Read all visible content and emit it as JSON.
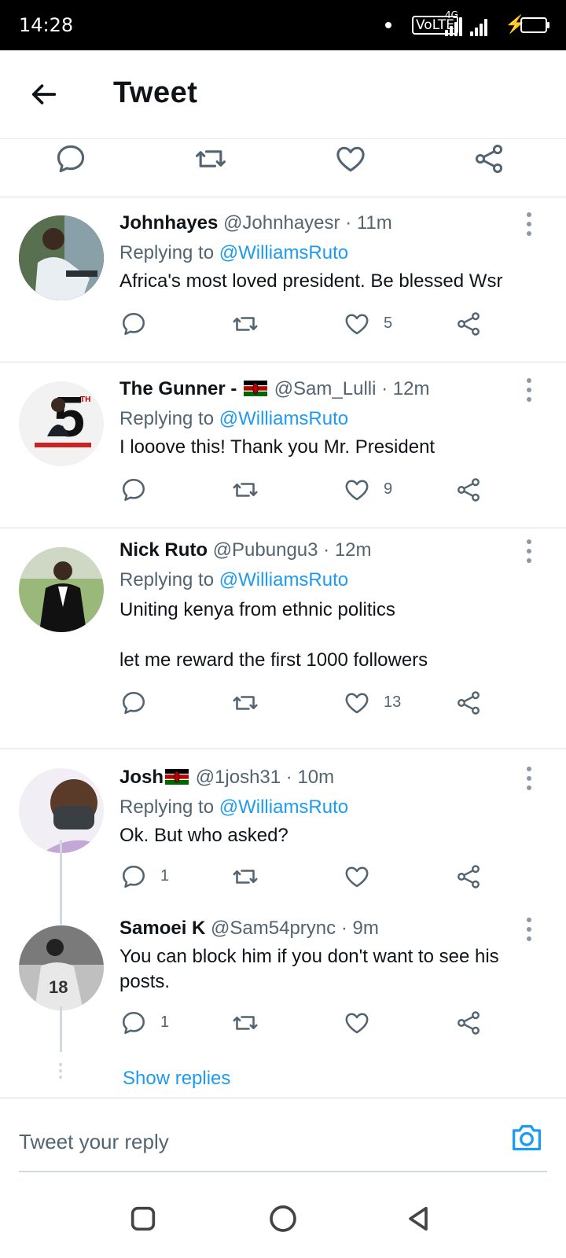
{
  "status": {
    "time": "14:28",
    "network": "VoLTE",
    "net_type": "4G"
  },
  "header": {
    "title": "Tweet"
  },
  "tweets": [
    {
      "name": "Johnhayes",
      "handle": "@Johnhayesr",
      "time": "· 11m",
      "replying_label": "Replying to",
      "replying_to": "@WilliamsRuto",
      "text": "Africa's most loved president. Be blessed Wsr",
      "likes": "5",
      "replies": ""
    },
    {
      "name": "The Gunner -",
      "handle": "@Sam_Lulli",
      "time": "· 12m",
      "replying_label": "Replying to",
      "replying_to": "@WilliamsRuto",
      "text": "I looove this! Thank you Mr. President",
      "likes": "9",
      "replies": ""
    },
    {
      "name": "Nick Ruto",
      "handle": "@Pubungu3",
      "time": "· 12m",
      "replying_label": "Replying to",
      "replying_to": "@WilliamsRuto",
      "text": "Uniting kenya from ethnic politics",
      "text2": "let me reward the first 1000 followers",
      "likes": "13",
      "replies": ""
    },
    {
      "name": "Josh",
      "handle": "@1josh31",
      "time": "· 10m",
      "replying_label": "Replying to",
      "replying_to": "@WilliamsRuto",
      "text": "Ok. But who asked?",
      "likes": "",
      "replies": "1"
    },
    {
      "name": "Samoei K",
      "handle": "@Sam54prync",
      "time": "· 9m",
      "text": "You can block him if you don't want to see his posts.",
      "likes": "",
      "replies": "1"
    }
  ],
  "show_replies": "Show replies",
  "composer": {
    "placeholder": "Tweet your reply"
  },
  "icons": [
    "back-arrow-icon",
    "reply-icon",
    "retweet-icon",
    "like-icon",
    "share-icon",
    "more-icon",
    "camera-icon",
    "kenya-flag-icon"
  ],
  "colors": {
    "link": "#1d9bf0",
    "muted": "#536471",
    "text": "#0f1419"
  }
}
